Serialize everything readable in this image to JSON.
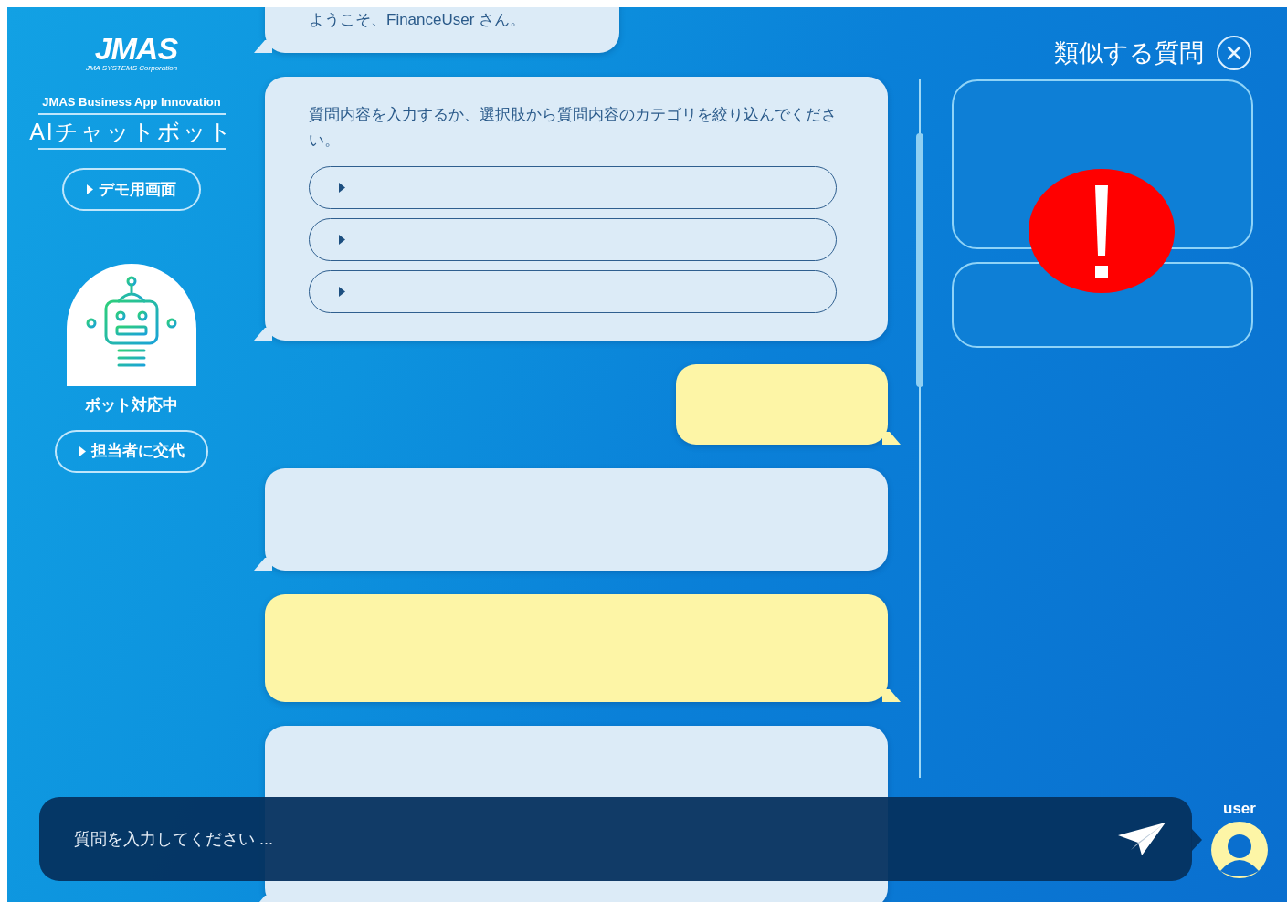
{
  "sidebar": {
    "logo": {
      "mark": "JMAS",
      "tagline": "JMA SYSTEMS Corporation"
    },
    "subtitle": "JMAS Business App Innovation",
    "title": "AIチャットボット",
    "demo_button": "デモ用画面",
    "status": "ボット対応中",
    "handoff_button": "担当者に交代"
  },
  "messages": [
    {
      "kind": "bot",
      "text": "ようこそ、FinanceUser さん。"
    },
    {
      "kind": "bot",
      "text": "質問内容を入力するか、選択肢から質問内容のカテゴリを絞り込んでください。",
      "options": [
        {
          "kind": "option"
        },
        {
          "kind": "option"
        },
        {
          "kind": "option"
        }
      ]
    },
    {
      "kind": "user"
    },
    {
      "kind": "bot"
    },
    {
      "kind": "user"
    },
    {
      "kind": "bot"
    }
  ],
  "similar_panel": {
    "title": "類似する質問",
    "cards": [
      {
        "kind": "card"
      },
      {
        "kind": "card"
      }
    ]
  },
  "alert": {
    "kind": "warning"
  },
  "input": {
    "placeholder": "質問を入力してください ..."
  },
  "user": {
    "label": "user"
  }
}
